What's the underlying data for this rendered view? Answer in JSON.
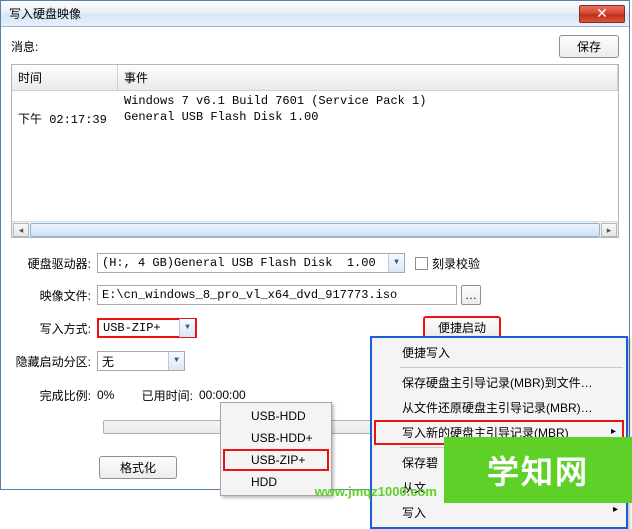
{
  "window": {
    "title": "写入硬盘映像"
  },
  "close_x": "✕",
  "save_btn": "保存",
  "messages_label": "消息:",
  "table": {
    "headers": {
      "time": "时间",
      "event": "事件"
    },
    "rows": [
      {
        "time": "",
        "event": "Windows 7 v6.1 Build 7601 (Service Pack 1)"
      },
      {
        "time": "下午 02:17:39",
        "event": "General USB Flash Disk  1.00"
      }
    ]
  },
  "form": {
    "drive_label": "硬盘驱动器:",
    "drive_value": "(H:, 4 GB)General USB Flash Disk  1.00",
    "burn_verify": "刻录校验",
    "image_label": "映像文件:",
    "image_value": "E:\\cn_windows_8_pro_vl_x64_dvd_917773.iso",
    "write_mode_label": "写入方式:",
    "write_mode_value": "USB-ZIP+",
    "quick_boot_btn": "便捷启动",
    "hidden_part_label": "隐藏启动分区:",
    "hidden_part_value": "无",
    "progress_label": "完成比例:",
    "progress_value": "0%",
    "elapsed_label": "已用时间:",
    "elapsed_value": "00:00:00",
    "format_btn": "格式化",
    "browse_icon": "…"
  },
  "menu1": {
    "items": [
      "USB-HDD",
      "USB-HDD+",
      "USB-ZIP+",
      "HDD"
    ]
  },
  "menu2": {
    "quick_write": "便捷写入",
    "save_mbr_file": "保存硬盘主引导记录(MBR)到文件…",
    "restore_mbr_file": "从文件还原硬盘主引导记录(MBR)…",
    "write_new_mbr": "写入新的硬盘主引导记录(MBR)",
    "save_partial": "保存碧",
    "from_file_partial": "从文",
    "write_partial": "写入"
  },
  "watermark": {
    "text": "学知网",
    "url": "www.jmqz1000.com"
  }
}
